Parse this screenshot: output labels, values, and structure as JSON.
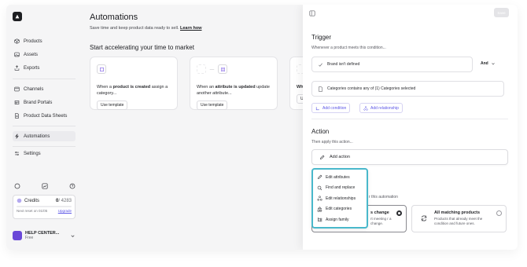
{
  "sidebar": {
    "logo_icon": "brand-logo-icon",
    "items": [
      {
        "label": "Products",
        "icon": "cube-icon"
      },
      {
        "label": "Assets",
        "icon": "image-icon"
      },
      {
        "label": "Exports",
        "icon": "export-icon"
      },
      {
        "label": "Channels",
        "icon": "channels-icon"
      },
      {
        "label": "Brand Portals",
        "icon": "portal-icon"
      },
      {
        "label": "Product Data Sheets",
        "icon": "sheet-icon"
      },
      {
        "label": "Automations",
        "icon": "bolt-icon"
      },
      {
        "label": "Settings",
        "icon": "settings-icon"
      }
    ],
    "credits": {
      "label": "Credits",
      "used": "0",
      "total": "/ 4283",
      "reset": "Next reset on 01/05",
      "upgrade": "Upgrade"
    },
    "account": {
      "name": "HELP CENTER...",
      "plan": "Free"
    }
  },
  "main": {
    "title": "Automations",
    "subtitle": "Save time and keep product data ready to sell.",
    "learn_more": "Learn how",
    "section": "Start accelerating your time to market",
    "templates": [
      {
        "pre": "When a ",
        "bold": "product is created",
        "post": " assign a category...",
        "button": "Use template"
      },
      {
        "pre": "When an ",
        "bold": "attribute is updated",
        "post": " update another attribute...",
        "button": "Use template"
      },
      {
        "pre": "Wh",
        "bold": "",
        "post": "",
        "button": "Us"
      }
    ]
  },
  "drawer": {
    "save": "Save",
    "trigger_title": "Trigger",
    "trigger_sub": "Whenever a product meets this condition...",
    "condition1": "Brand isn't defined",
    "and_label": "And",
    "condition2": "Categories contains any of (1) Categories selected",
    "add_condition": "Add condition",
    "add_relationship": "Add relationship",
    "action_title": "Action",
    "action_sub": "Then apply this action...",
    "add_action": "Add action",
    "scope_note": "r this automation",
    "option_a": {
      "title": "s change",
      "desc": "rt meeting\nr a change."
    },
    "option_b": {
      "title": "All matching products",
      "desc": "Products that already meet the condition and future ones."
    }
  },
  "menu": {
    "items": [
      {
        "label": "Edit attributes",
        "icon": "pencil-icon"
      },
      {
        "label": "Find and replace",
        "icon": "search-icon"
      },
      {
        "label": "Edit relationships",
        "icon": "relationship-icon"
      },
      {
        "label": "Edit categories",
        "icon": "categories-icon"
      },
      {
        "label": "Assign family",
        "icon": "family-icon"
      }
    ]
  },
  "colors": {
    "accent": "#5b55e6",
    "highlight": "#49b8cb",
    "avatar": "#6a48d8"
  }
}
